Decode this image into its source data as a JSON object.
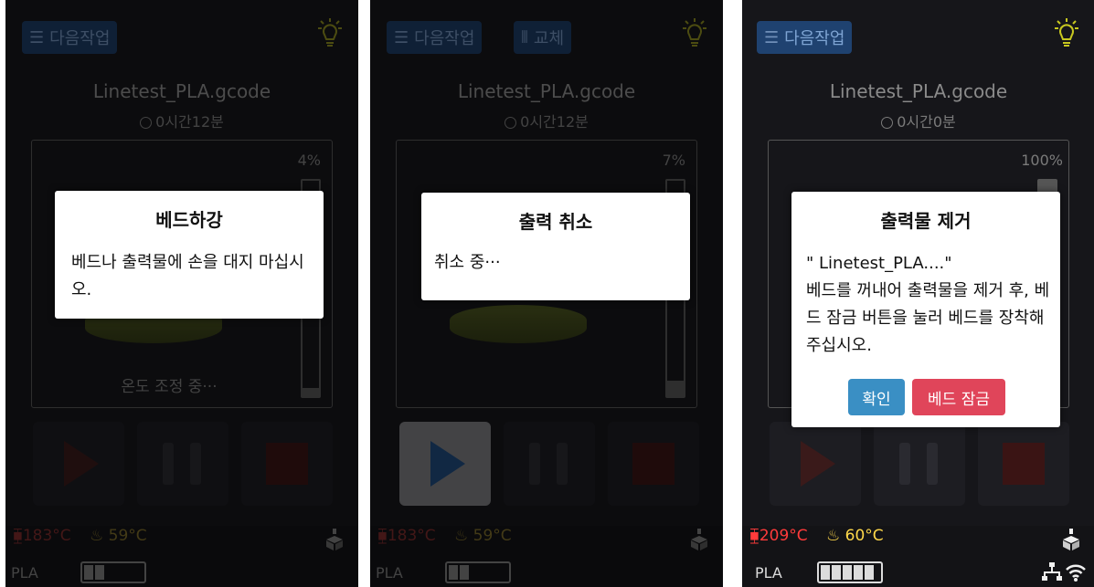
{
  "screens": [
    {
      "top_buttons": [
        "다음작업"
      ],
      "file_name": "Linetest_PLA.gcode",
      "time": "0시간12분",
      "progress_pct": "4%",
      "progress_fraction": 0.04,
      "panel_note": "온도 조정 중···",
      "nozzle_temp": "183°C",
      "bed_temp": "59°C",
      "material": "PLA",
      "modal": {
        "title": "베드하강",
        "body": "베드나 출력물에 손을 대지 마십시오."
      },
      "colors": {
        "nozzle": "#7a2b2b",
        "bed": "#7a6a2a"
      }
    },
    {
      "top_buttons": [
        "다음작업",
        "교체"
      ],
      "file_name": "Linetest_PLA.gcode",
      "time": "0시간12분",
      "progress_pct": "7%",
      "progress_fraction": 0.07,
      "nozzle_temp": "183°C",
      "bed_temp": "59°C",
      "material": "PLA",
      "modal": {
        "title": "출력 취소",
        "body": "취소 중···"
      }
    },
    {
      "top_buttons": [
        "다음작업"
      ],
      "file_name": "Linetest_PLA.gcode",
      "time": "0시간0분",
      "progress_pct": "100%",
      "progress_fraction": 1.0,
      "nozzle_temp": "209°C",
      "bed_temp": "60°C",
      "material": "PLA",
      "modal": {
        "title": "출력물 제거",
        "body_line1": "\" Linetest_PLA....\"",
        "body_line2": "베드를 꺼내어 출력물을 제거 후, 베드 잠금 버튼을 눌러 베드를 장착해 주십시오.",
        "ok_label": "확인",
        "lock_label": "베드 잠금"
      },
      "colors": {
        "nozzle": "#ff3b3b",
        "bed": "#ffd84a",
        "ok": "#3a8fc4",
        "lock": "#e0455a"
      }
    }
  ],
  "icons": [
    "list-icon",
    "lightbulb-icon",
    "clock-icon",
    "nozzle-icon",
    "bed-heat-icon",
    "cube-icon",
    "filament-swap-icon",
    "network-icon",
    "wifi-icon"
  ]
}
